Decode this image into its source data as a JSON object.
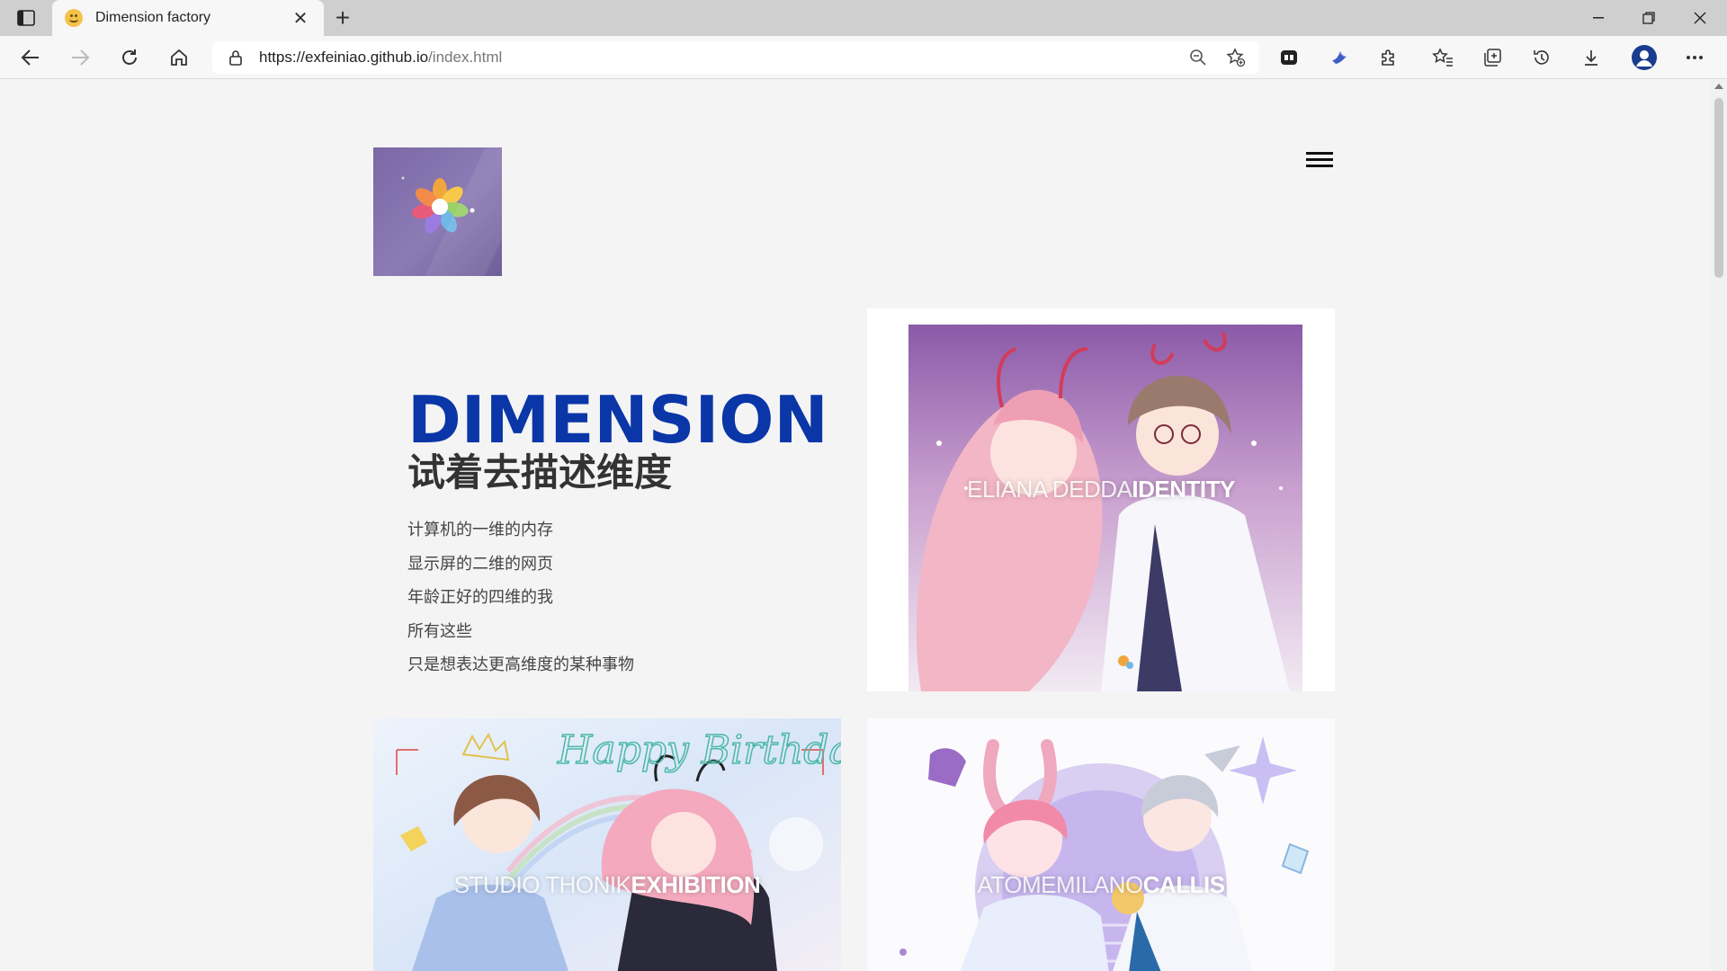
{
  "browser": {
    "tab_title": "Dimension factory",
    "url_host": "https://exfeiniao.github.io",
    "url_path": "/index.html"
  },
  "page": {
    "hero": {
      "title": "DIMENSION",
      "subtitle": "试着去描述维度",
      "lines": [
        "计算机的一维的内存",
        "显示屏的二维的网页",
        "年龄正好的四维的我",
        "所有这些",
        "只是想表达更高维度的某种事物"
      ]
    },
    "cards": [
      {
        "caption_light": "ELIANA DEDDA",
        "caption_bold": "IDENTITY"
      },
      {
        "caption_light": "STUDIO THONIK",
        "caption_bold": "EXHIBITION"
      },
      {
        "caption_light": "ATOMEMILANO",
        "caption_bold": "CALLIS"
      }
    ],
    "card_art_text": "Happy Birthday"
  },
  "colors": {
    "accent": "#0a36a8",
    "text": "#333333",
    "background": "#f4f4f4"
  }
}
